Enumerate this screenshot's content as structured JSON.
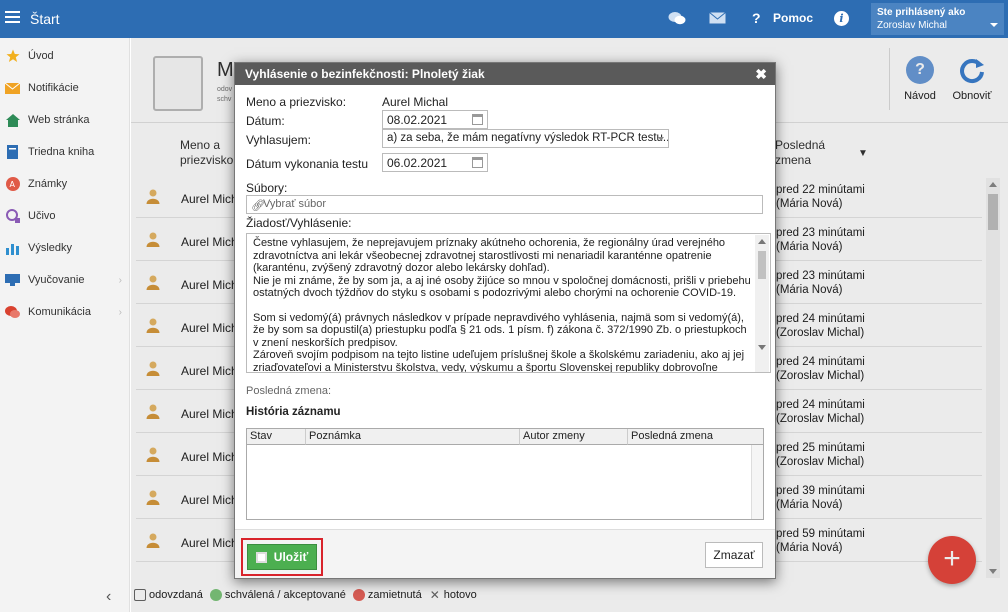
{
  "topbar": {
    "title": "Štart",
    "help_label": "Pomoc",
    "info_label": "i",
    "user_prefix": "Ste prihlásený ako",
    "user_name": "Zoroslav Michal"
  },
  "sidebar": {
    "items": [
      {
        "label": "Úvod",
        "icon": "star-icon"
      },
      {
        "label": "Notifikácie",
        "icon": "envelope-icon"
      },
      {
        "label": "Web stránka",
        "icon": "home-icon"
      },
      {
        "label": "Triedna kniha",
        "icon": "book-icon"
      },
      {
        "label": "Známky",
        "icon": "grade-icon"
      },
      {
        "label": "Učivo",
        "icon": "lesson-icon"
      },
      {
        "label": "Výsledky",
        "icon": "bar-chart-icon"
      },
      {
        "label": "Vyučovanie",
        "icon": "teaching-icon"
      },
      {
        "label": "Komunikácia",
        "icon": "chat-icon"
      }
    ],
    "collapse_glyph": "‹"
  },
  "background": {
    "page_title": "M",
    "page_subtitle_1": "odov",
    "page_subtitle_2": "schv",
    "tools": [
      {
        "label": "Návod"
      },
      {
        "label": "Obnoviť"
      }
    ],
    "col_name_1": "Meno a",
    "col_name_2": "priezvisko",
    "col_change_1": "Posledná",
    "col_change_2": "zmena",
    "sort_glyph": "▼",
    "rows": [
      {
        "name": "Aurel Michal",
        "time": "pred 22 minútami",
        "by": "(Mária Nová)"
      },
      {
        "name": "Aurel Michal",
        "time": "pred 23 minútami",
        "by": "(Mária Nová)"
      },
      {
        "name": "Aurel Michal",
        "time": "pred 23 minútami",
        "by": "(Mária Nová)"
      },
      {
        "name": "Aurel Michal",
        "time": "pred 24 minútami",
        "by": "(Zoroslav Michal)"
      },
      {
        "name": "Aurel Michal",
        "time": "pred 24 minútami",
        "by": "(Zoroslav Michal)"
      },
      {
        "name": "Aurel Michal",
        "time": "pred 24 minútami",
        "by": "(Zoroslav Michal)"
      },
      {
        "name": "Aurel Michal",
        "time": "pred 25 minútami",
        "by": "(Zoroslav Michal)"
      },
      {
        "name": "Aurel Michal",
        "time": "pred 39 minútami",
        "by": "(Mária Nová)"
      },
      {
        "name": "Aurel Michal",
        "time": "pred 59 minútami",
        "by": "(Mária Nová)"
      }
    ],
    "fab_label": "+",
    "legend": [
      {
        "label": "odovzdaná",
        "color": "#ffffff"
      },
      {
        "label": "schválená / akceptované",
        "color": "#7dc67b"
      },
      {
        "label": "zamietnutá",
        "color": "#e8635b"
      },
      {
        "label": "hotovo",
        "color": "#888888"
      }
    ]
  },
  "modal": {
    "title": "Vyhlásenie o bezinfekčnosti: Plnoletý žiak",
    "close_glyph": "✖",
    "name_label": "Meno a priezvisko:",
    "name_value": "Aurel Michal",
    "date_label": "Dátum:",
    "date_value": "08.02.2021",
    "declare_label": "Vyhlasujem:",
    "declare_value": "a) za seba, že mám negatívny výsledok RT-PCR testu...",
    "test_date_label": "Dátum vykonania testu",
    "test_date_value": "06.02.2021",
    "files_label": "Súbory:",
    "files_placeholder": "Vybrať súbor",
    "request_label": "Žiadosť/Vyhlásenie:",
    "request_text_1": "Čestne vyhlasujem, že neprejavujem príznaky akútneho ochorenia, že regionálny úrad verejného zdravotníctva ani lekár všeobecnej zdravotnej starostlivosti mi nenariadil karanténne opatrenie (karanténu, zvýšený zdravotný dozor alebo lekársky dohľad).",
    "request_text_2": "Nie je mi známe, že by som ja, a aj iné osoby žijúce so mnou v spoločnej domácnosti, prišli v priebehu ostatných dvoch týždňov do styku s osobami s podozrivými alebo chorými na ochorenie COVID-19.",
    "request_text_3": "Som si vedomý(á) právnych následkov v prípade nepravdivého vyhlásenia, najmä som si vedomý(á), že by som sa dopustil(a) priestupku podľa § 21 ods. 1 písm. f) zákona č. 372/1990 Zb. o priestupkoch v znení neskorších predpisov.",
    "request_text_4": "Zároveň svojím podpisom na tejto listine udeľujem príslušnej škole a školskému zariadeniu, ako aj jej zriaďovateľovi a Ministerstvu školstva, vedy, výskumu a športu Slovenskej republiky dobrovoľne súhlas so spracovaním osobných údajov v rozsahu tu uvedenom, za účelom riadneho zabezpečenia",
    "last_change_label": "Posledná zmena:",
    "history_title": "História záznamu",
    "history_columns": [
      "Stav",
      "Poznámka",
      "Autor zmeny",
      "Posledná zmena"
    ],
    "save_label": "Uložiť",
    "delete_label": "Zmazať"
  }
}
